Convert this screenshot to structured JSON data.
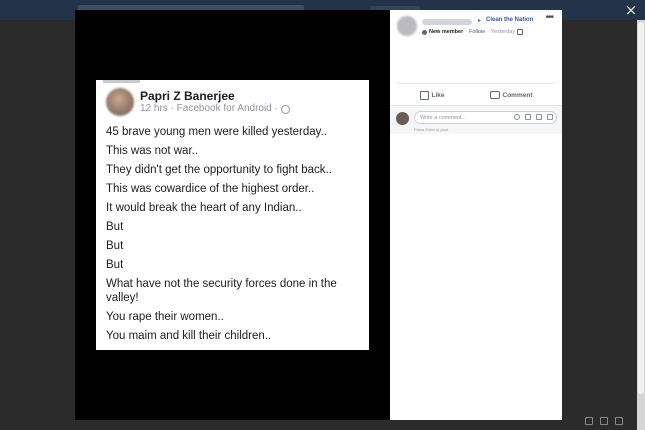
{
  "viewer": {
    "close_glyph": "×"
  },
  "post_image": {
    "author_name": "Papri Z Banerjee",
    "meta": "12 hrs · Facebook for Android ·",
    "lines": [
      "45 brave young men were killed yesterday..",
      "This was not war..",
      "They didn't get the opportunity to fight back..",
      "This was cowardice of the highest order..",
      "It would break the heart of any Indian..",
      "But",
      "But",
      "But",
      "What have not the security forces done in the valley!",
      "You rape their women..",
      "You maim and kill their children.."
    ]
  },
  "side_panel": {
    "arrow": "▸",
    "group_name": "Clean the Nation",
    "more_glyph": "•••",
    "member_label": "New member",
    "follow_label": "Follow",
    "dot": "·",
    "time": "Yesterday",
    "actions": {
      "like": "Like",
      "comment": "Comment"
    },
    "comment_placeholder": "Write a comment...",
    "comment_hint": "Press Enter to post."
  },
  "icons": {
    "close": "close-icon",
    "globe": "globe-icon",
    "like": "like-icon",
    "comment": "comment-icon",
    "more": "more-options-icon"
  },
  "colors": {
    "topbar": "#233349",
    "backdrop": "#2b2b2b",
    "group_link": "#385898"
  }
}
